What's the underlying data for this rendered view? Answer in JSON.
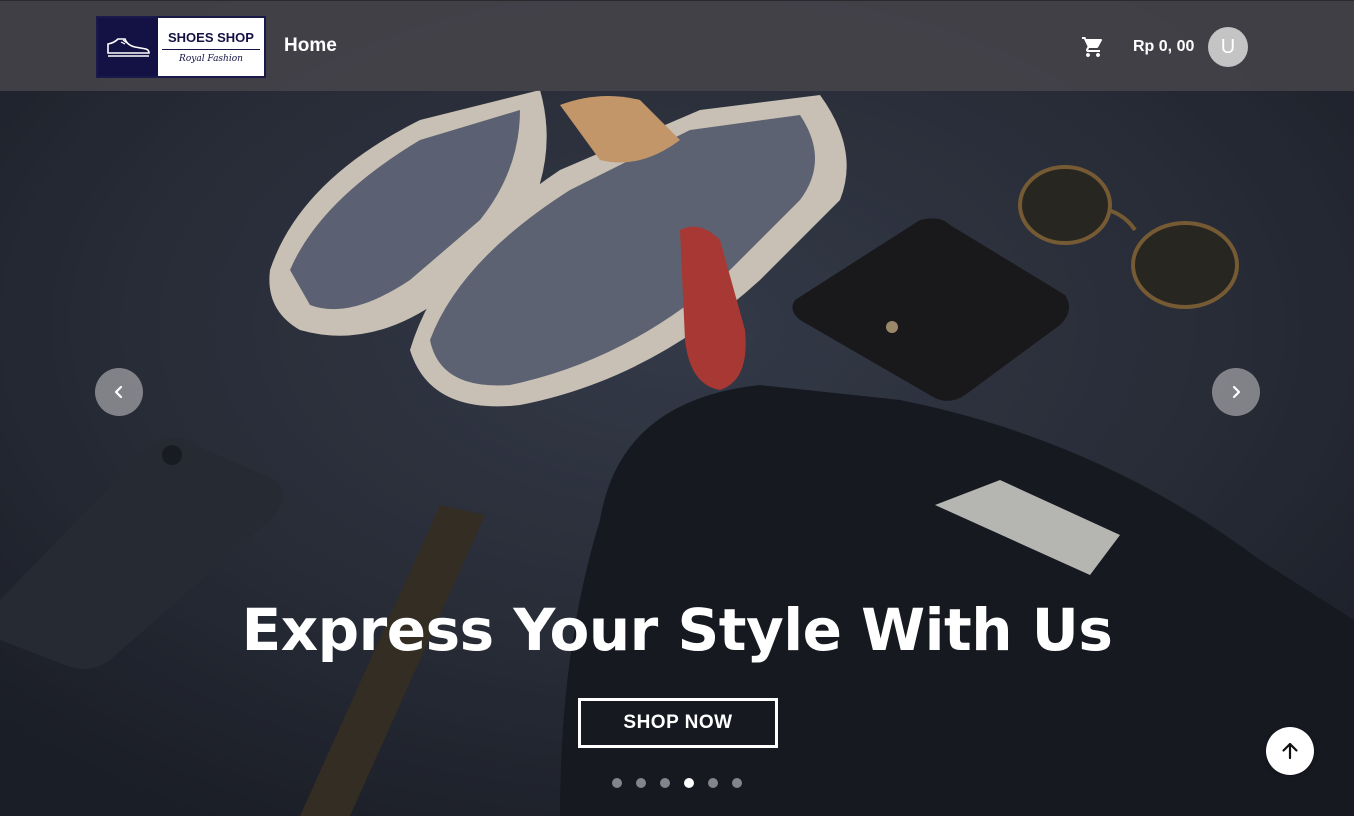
{
  "header": {
    "logo": {
      "title": "SHOES SHOP",
      "subtitle": "Royal Fashion"
    },
    "nav": [
      {
        "label": "Home"
      }
    ],
    "cart_icon": "shopping-cart-icon",
    "cart_total": "Rp 0, 00",
    "avatar_initial": "U"
  },
  "carousel": {
    "prev_icon": "chevron-left-icon",
    "next_icon": "chevron-right-icon",
    "headline": "Express Your Style With Us",
    "cta_label": "SHOP NOW",
    "slide_count": 6,
    "active_slide": 4
  },
  "scroll_top_icon": "arrow-up-icon",
  "colors": {
    "logo_navy": "#141244",
    "nav_bar": "#48464c",
    "text": "#ffffff",
    "avatar": "#c4c4c4"
  }
}
